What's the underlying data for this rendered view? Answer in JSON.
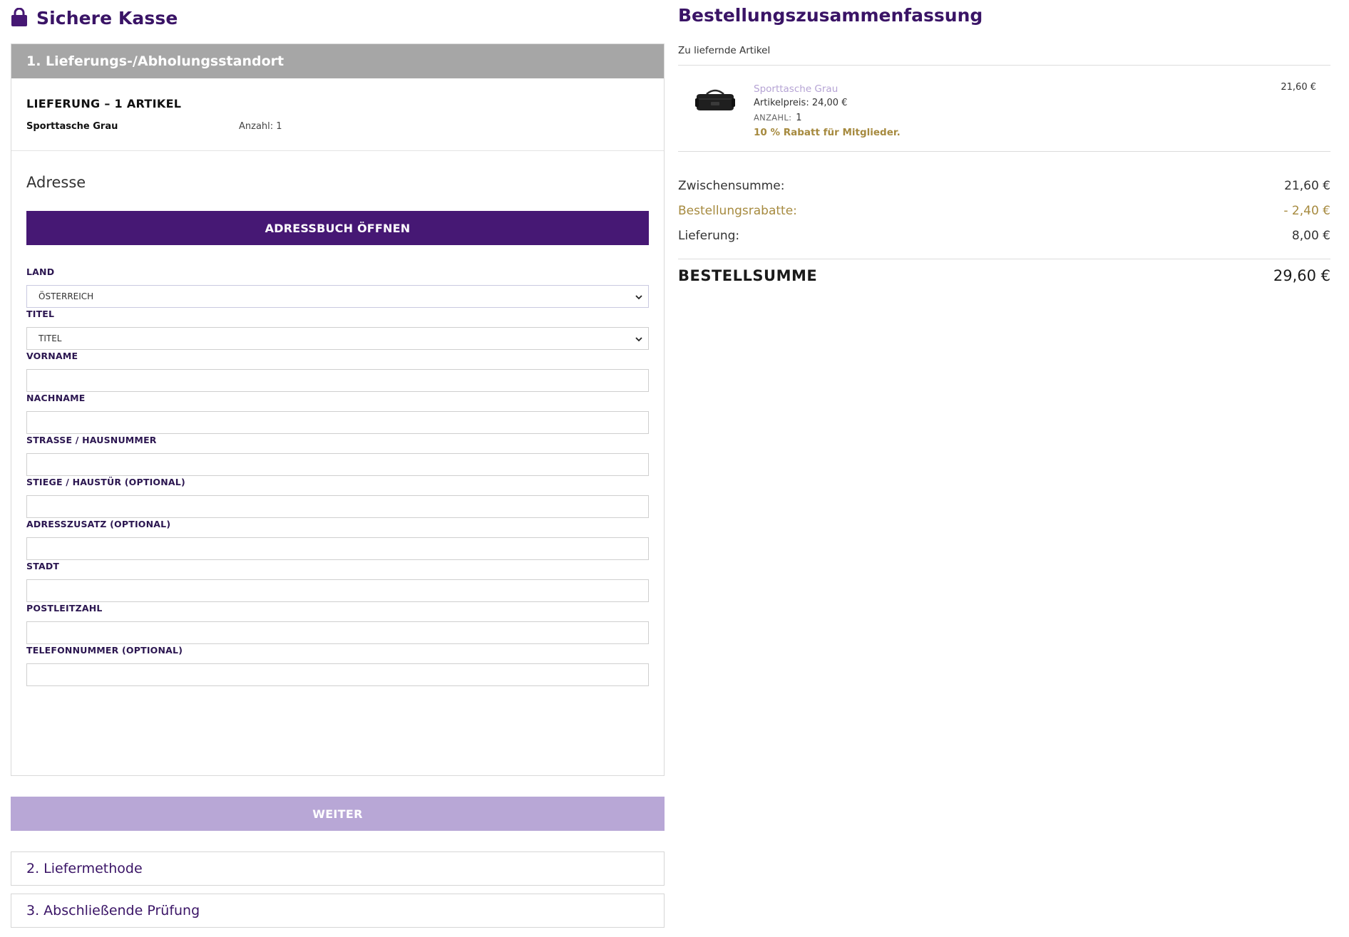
{
  "header": {
    "title": "Sichere Kasse",
    "lock_icon": "lock-icon"
  },
  "step1": {
    "title": "1. Lieferungs-/Abholungsstandort",
    "delivery_title": "LIEFERUNG – 1 ARTIKEL",
    "item_name": "Sporttasche Grau",
    "item_qty": "Anzahl: 1",
    "address_heading": "Adresse",
    "address_book_button": "ADRESSBUCH ÖFFNEN",
    "fields": {
      "country": {
        "label": "LAND",
        "value": "ÖSTERREICH"
      },
      "title": {
        "label": "TITEL",
        "value": "TITEL"
      },
      "firstname": {
        "label": "VORNAME",
        "value": ""
      },
      "lastname": {
        "label": "NACHNAME",
        "value": ""
      },
      "street": {
        "label": "STRASSE / HAUSNUMMER",
        "value": ""
      },
      "stair": {
        "label": "STIEGE / HAUSTÜR (OPTIONAL)",
        "value": ""
      },
      "addition": {
        "label": "ADRESSZUSATZ (OPTIONAL)",
        "value": ""
      },
      "city": {
        "label": "STADT",
        "value": ""
      },
      "zip": {
        "label": "POSTLEITZAHL",
        "value": ""
      },
      "phone": {
        "label": "TELEFONNUMMER (OPTIONAL)",
        "value": ""
      }
    },
    "continue_button": "WEITER"
  },
  "step2": {
    "title": "2. Liefermethode"
  },
  "step3": {
    "title": "3. Abschließende Prüfung"
  },
  "summary": {
    "title": "Bestellungszusammenfassung",
    "items_label": "Zu liefernde Artikel",
    "item": {
      "name": "Sporttasche Grau",
      "price_label": "Artikelpreis:",
      "price_value": "24,00 €",
      "qty_label": "ANZAHL:",
      "qty_value": "1",
      "promo": "10 % Rabatt für Mitglieder.",
      "line_total": "21,60 €"
    },
    "subtotal_label": "Zwischensumme:",
    "subtotal_value": "21,60 €",
    "discount_label": "Bestellungsrabatte:",
    "discount_value": "- 2,40 €",
    "shipping_label": "Lieferung:",
    "shipping_value": "8,00 €",
    "total_label": "BESTELLSUMME",
    "total_value": "29,60 €"
  },
  "colors": {
    "brand_purple": "#461874",
    "heading_purple": "#3a1466",
    "weiter_disabled": "#b8a7d6",
    "step_header_grey": "#a6a6a6",
    "discount_gold": "#a68a3f"
  }
}
